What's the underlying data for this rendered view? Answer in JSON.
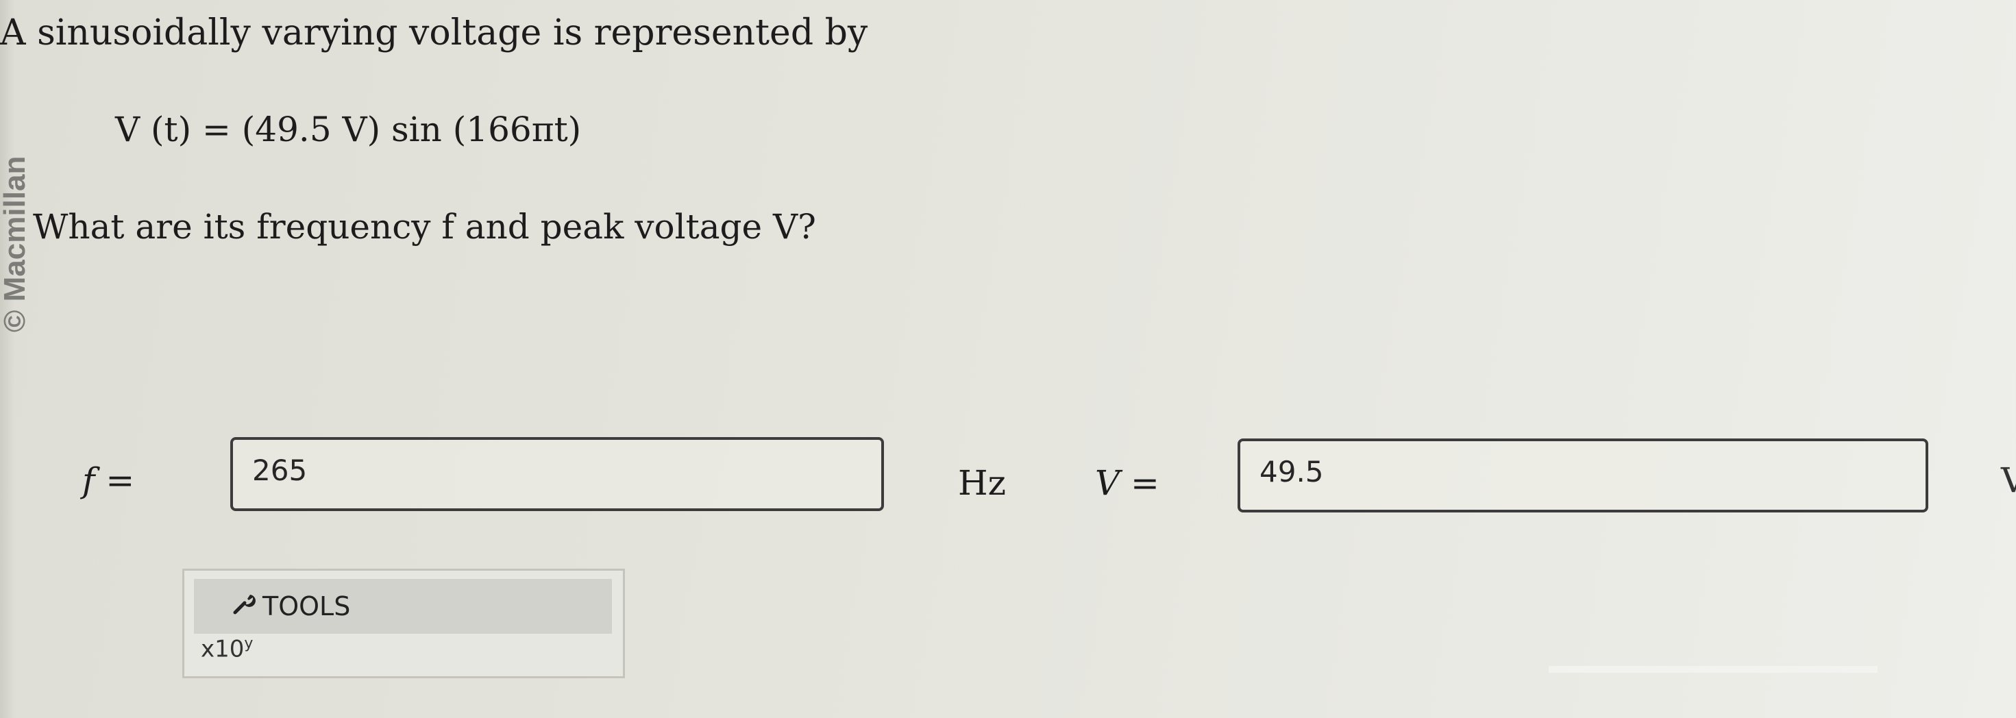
{
  "question": {
    "intro": "A sinusoidally varying voltage is represented by",
    "equation": "V (t) = (49.5 V) sin (166πt)",
    "prompt": "What are its frequency f and peak voltage V?"
  },
  "credit": "© Macmillan",
  "answers": {
    "frequency": {
      "label": "f =",
      "value": "265",
      "unit": "Hz"
    },
    "voltage": {
      "label": "V =",
      "value": "49.5",
      "unit_partial": "V"
    }
  },
  "tools": {
    "label": "TOOLS",
    "icon": "wrench-icon",
    "sci_notation_base": "x10",
    "sci_notation_exp": "y"
  }
}
